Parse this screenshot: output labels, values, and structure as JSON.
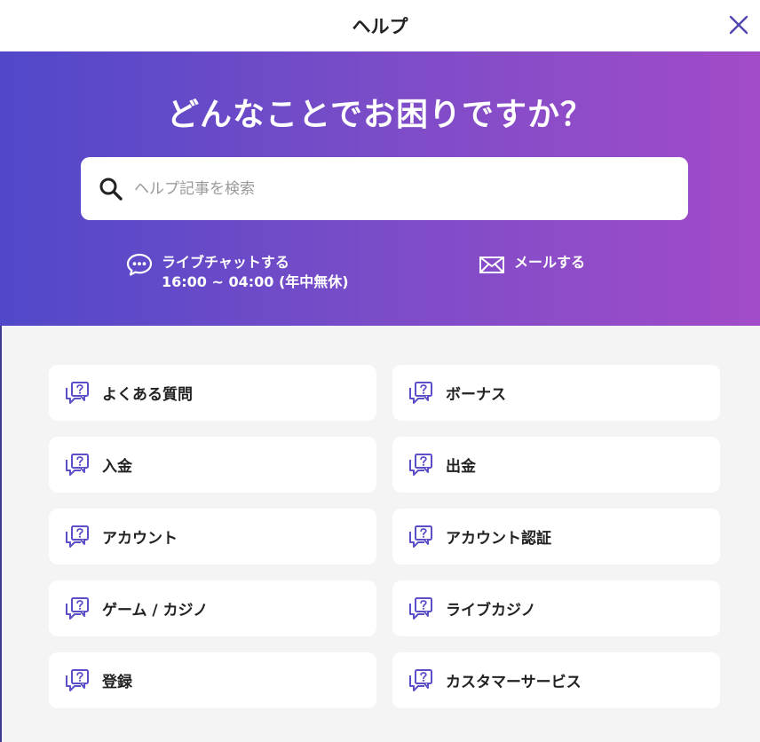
{
  "header": {
    "title": "ヘルプ",
    "close_icon": "close-icon"
  },
  "hero": {
    "title": "どんなことでお困りですか？",
    "search": {
      "placeholder": "ヘルプ記事を検索",
      "value": "",
      "icon": "search-icon"
    },
    "live_chat": {
      "label": "ライブチャットする",
      "hours": "16:00 ~ 04:00 (年中無休)",
      "icon": "chat-bubble-icon"
    },
    "email": {
      "label": "メールする",
      "icon": "envelope-icon"
    }
  },
  "categories": [
    {
      "label": "よくある質問",
      "icon": "help-question-icon"
    },
    {
      "label": "ボーナス",
      "icon": "help-question-icon"
    },
    {
      "label": "入金",
      "icon": "help-question-icon"
    },
    {
      "label": "出金",
      "icon": "help-question-icon"
    },
    {
      "label": "アカウント",
      "icon": "help-question-icon"
    },
    {
      "label": "アカウント認証",
      "icon": "help-question-icon"
    },
    {
      "label": "ゲーム / カジノ",
      "icon": "help-question-icon"
    },
    {
      "label": "ライブカジノ",
      "icon": "help-question-icon"
    },
    {
      "label": "登録",
      "icon": "help-question-icon"
    },
    {
      "label": "カスタマーサービス",
      "icon": "help-question-icon"
    }
  ],
  "colors": {
    "accent": "#5a4fc8",
    "gradient_start": "#5048c9",
    "gradient_end": "#a24bc8",
    "background": "#f4f4f4",
    "card": "#ffffff"
  }
}
